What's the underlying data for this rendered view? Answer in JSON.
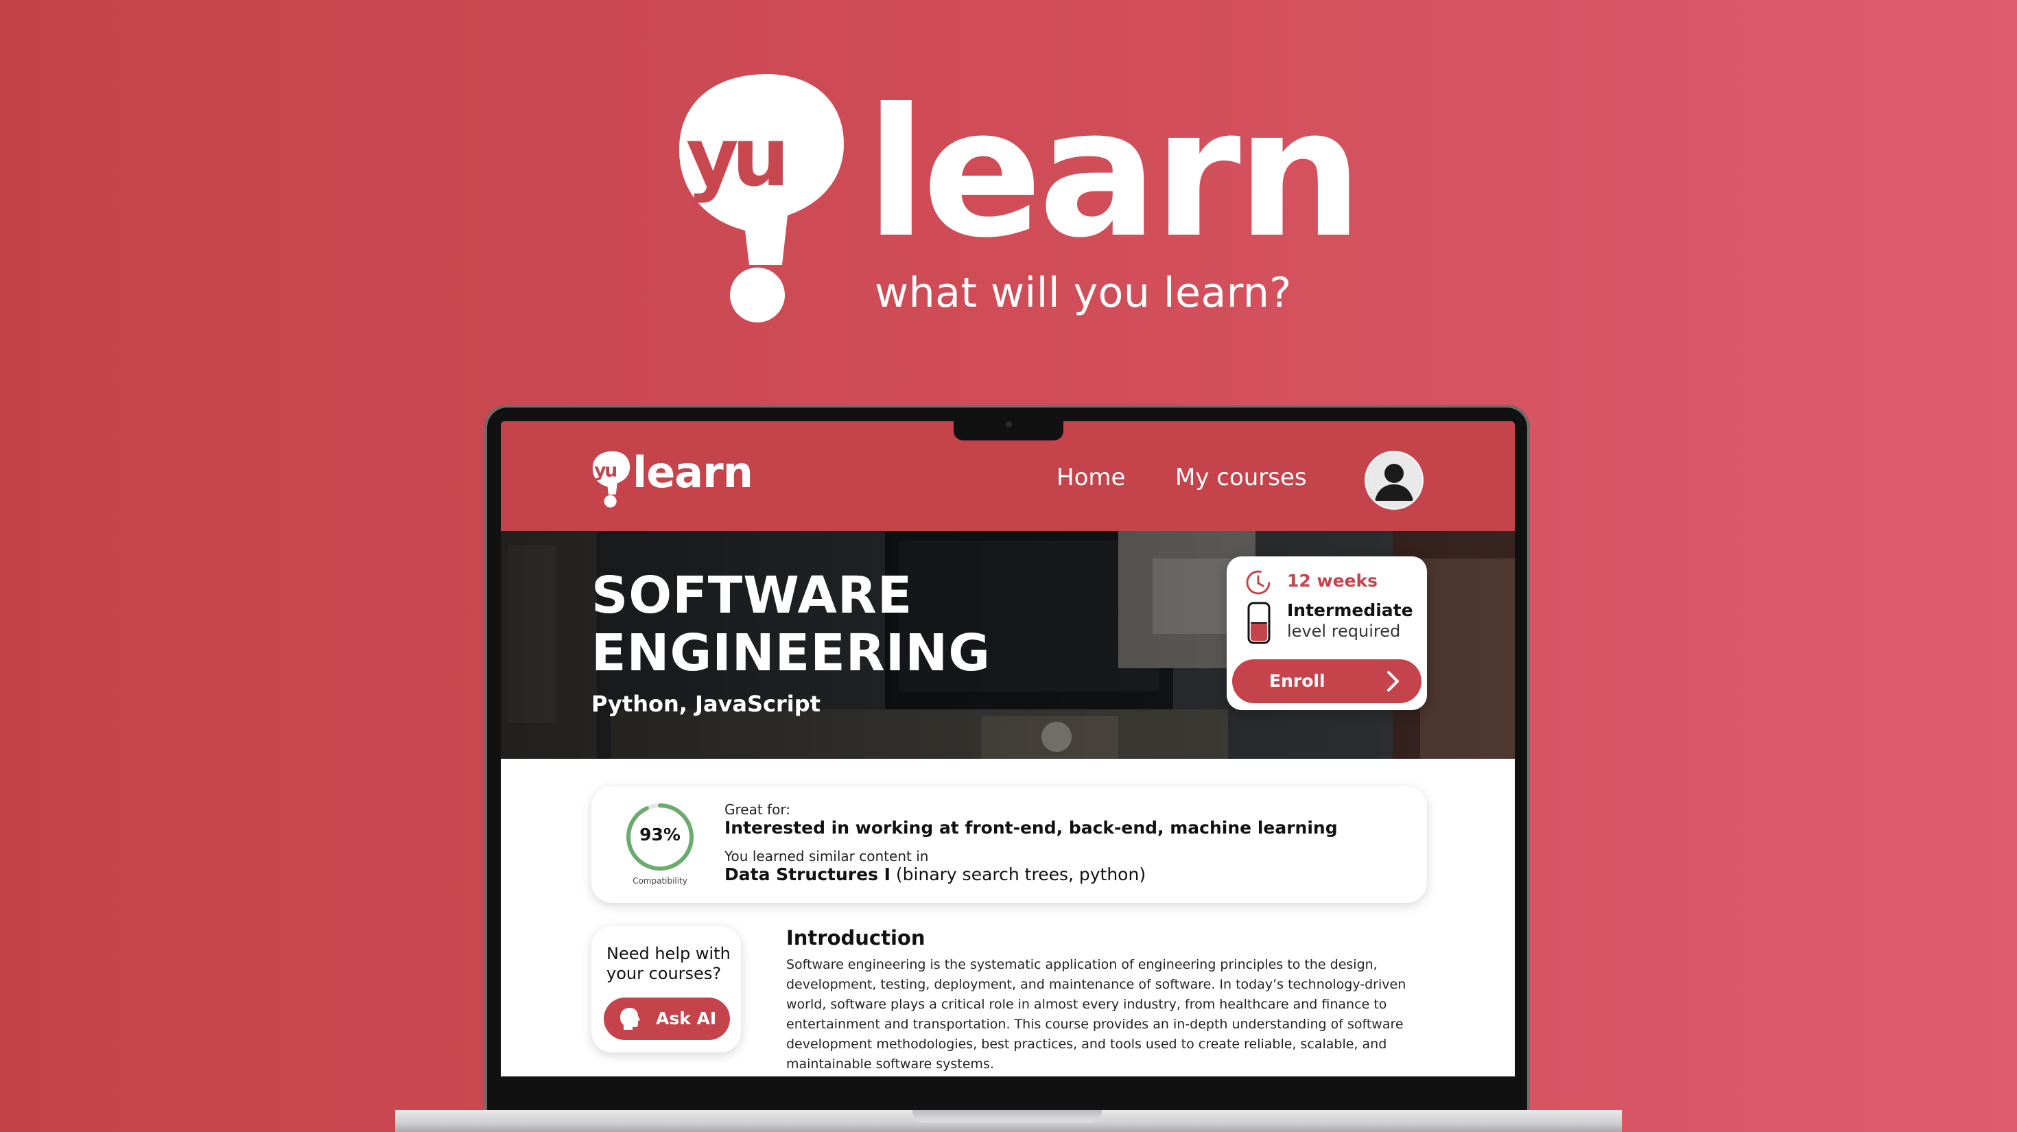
{
  "hero": {
    "brand_mark": "yu",
    "brand_word": "learn",
    "tagline": "what will you learn?"
  },
  "app": {
    "brand_mark": "yu",
    "brand_word": "learn",
    "nav": {
      "home": "Home",
      "my_courses": "My courses"
    },
    "avatar_icon": "user-avatar-icon"
  },
  "course": {
    "title": "SOFTWARE ENGINEERING",
    "languages": "Python, JavaScript",
    "duration": "12 weeks",
    "level": "Intermediate",
    "level_caption": "level required",
    "level_fill": 0.5,
    "enroll_label": "Enroll"
  },
  "match": {
    "compatibility_value": "93%",
    "compatibility_fraction": 0.93,
    "compatibility_caption": "Compatibility",
    "great_for_label": "Great for:",
    "great_for_value": "Interested in working at front-end, back-end, machine learning",
    "similar_label": "You learned similar content in",
    "similar_course": "Data Structures I",
    "similar_detail": " (binary search trees, python)"
  },
  "help": {
    "text": "Need help with your courses?",
    "button_label": "Ask AI"
  },
  "intro": {
    "title": "Introduction",
    "body": "Software engineering is the systematic application of engineering principles to the design, development, testing, deployment, and maintenance of software. In today’s technology-driven world, software plays a critical role in almost every industry, from healthcare and finance to entertainment and transportation. This course provides an in-depth understanding of software development methodologies, best practices, and tools used to create reliable, scalable, and maintainable software systems."
  },
  "colors": {
    "brand": "#c5434b",
    "gauge": "#6aab6e",
    "background_start": "#c4434a",
    "background_end": "#dd5c6e"
  }
}
